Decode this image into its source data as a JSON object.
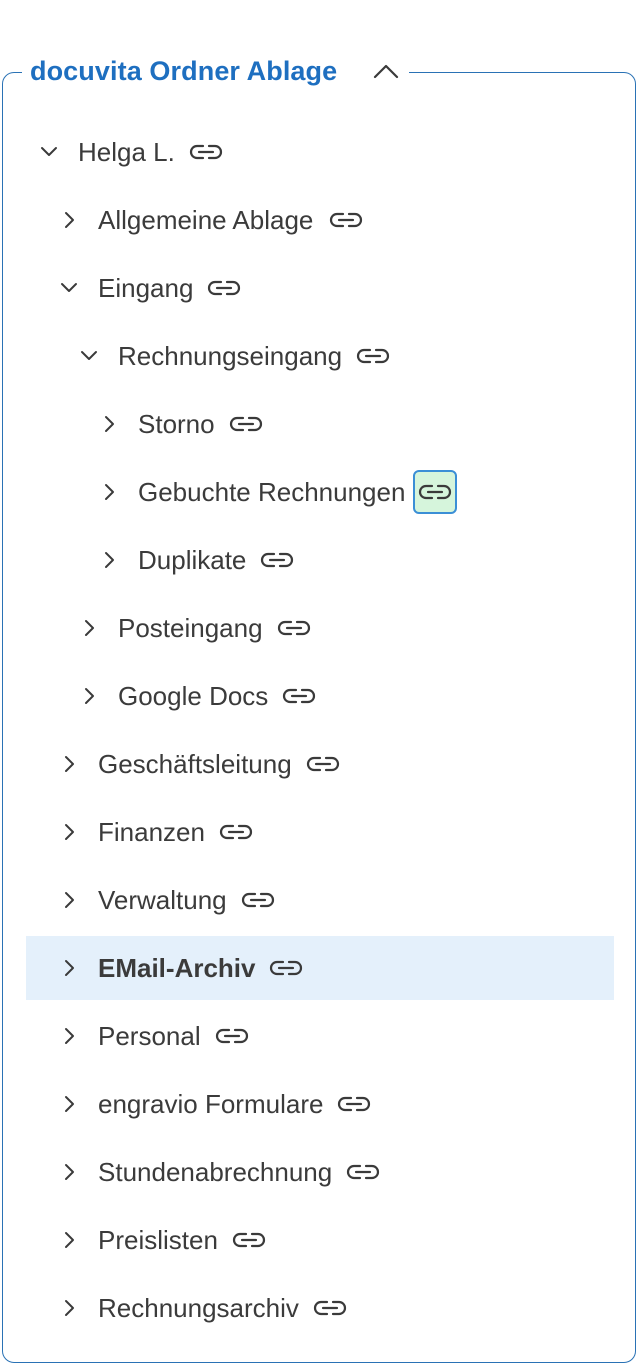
{
  "panel": {
    "title": "docuvita Ordner Ablage",
    "title_color": "#1e6fc0",
    "border_color": "#2a72b5",
    "collapse_icon": "chevron-up-icon"
  },
  "tree": [
    {
      "label": "Helga L.",
      "level": 0,
      "expanded": true
    },
    {
      "label": "Allgemeine Ablage",
      "level": 1,
      "expanded": false
    },
    {
      "label": "Eingang",
      "level": 1,
      "expanded": true
    },
    {
      "label": "Rechnungseingang",
      "level": 2,
      "expanded": true
    },
    {
      "label": "Storno",
      "level": 3,
      "expanded": false
    },
    {
      "label": "Gebuchte Rechnungen",
      "level": 3,
      "expanded": false,
      "link_active": true
    },
    {
      "label": "Duplikate",
      "level": 3,
      "expanded": false
    },
    {
      "label": "Posteingang",
      "level": 2,
      "expanded": false
    },
    {
      "label": "Google Docs",
      "level": 2,
      "expanded": false
    },
    {
      "label": "Geschäftsleitung",
      "level": 1,
      "expanded": false
    },
    {
      "label": "Finanzen",
      "level": 1,
      "expanded": false
    },
    {
      "label": "Verwaltung",
      "level": 1,
      "expanded": false
    },
    {
      "label": "EMail-Archiv",
      "level": 1,
      "expanded": false,
      "selected": true
    },
    {
      "label": "Personal",
      "level": 1,
      "expanded": false
    },
    {
      "label": "engravio Formulare",
      "level": 1,
      "expanded": false
    },
    {
      "label": "Stundenabrechnung",
      "level": 1,
      "expanded": false
    },
    {
      "label": "Preislisten",
      "level": 1,
      "expanded": false
    },
    {
      "label": "Rechnungsarchiv",
      "level": 1,
      "expanded": false
    }
  ],
  "colors": {
    "selected_bg": "#e4f0fb",
    "link_active_bg": "#d6f5dc",
    "link_active_border": "#3b8fd6"
  }
}
